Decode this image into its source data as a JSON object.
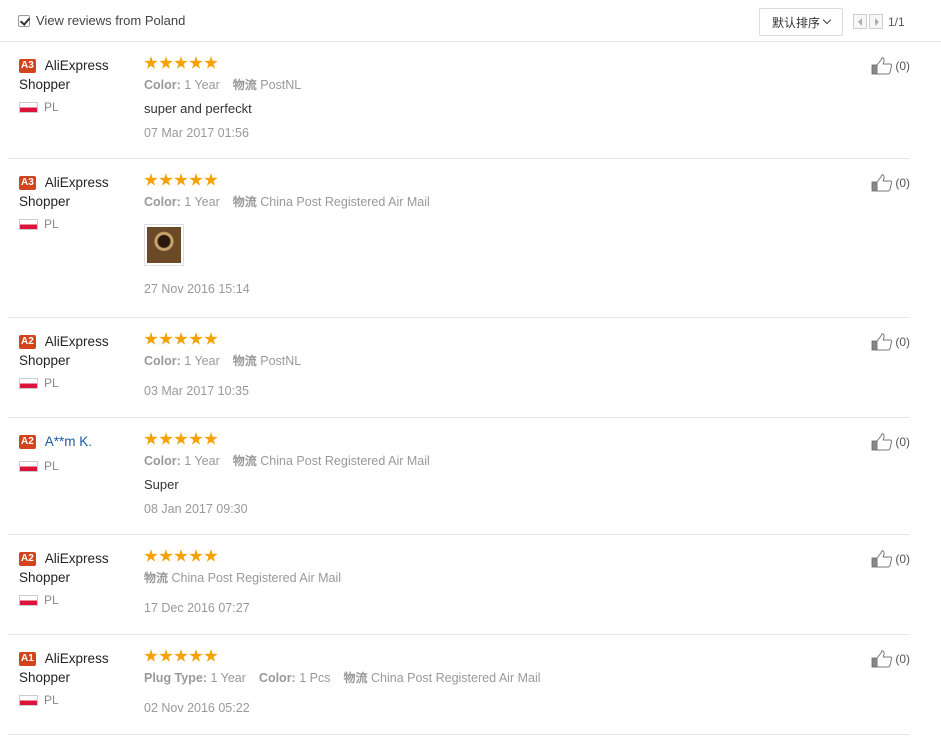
{
  "filter": {
    "label": "View reviews from Poland",
    "checked": true
  },
  "sort": {
    "label": "默认排序"
  },
  "pagination": {
    "text": "1/1"
  },
  "reviews": [
    {
      "level": "A3",
      "name": "AliExpress",
      "name2": "Shopper",
      "country": "PL",
      "stars": 5,
      "attrs": [
        {
          "label": "Color:",
          "value": "1 Year"
        },
        {
          "label": "物流",
          "value": "PostNL"
        }
      ],
      "text": "super and perfeckt",
      "date": "07 Mar 2017 01:56",
      "likes": "(0)"
    },
    {
      "level": "A3",
      "name": "AliExpress",
      "name2": "Shopper",
      "country": "PL",
      "stars": 5,
      "attrs": [
        {
          "label": "Color:",
          "value": "1 Year"
        },
        {
          "label": "物流",
          "value": "China Post Registered Air Mail"
        }
      ],
      "text": "",
      "photo": "review-photo-thumbnail",
      "date": "27 Nov 2016 15:14",
      "likes": "(0)"
    },
    {
      "level": "A2",
      "name": "AliExpress",
      "name2": "Shopper",
      "country": "PL",
      "stars": 5,
      "attrs": [
        {
          "label": "Color:",
          "value": "1 Year"
        },
        {
          "label": "物流",
          "value": "PostNL"
        }
      ],
      "text": "",
      "date": "03 Mar 2017 10:35",
      "likes": "(0)"
    },
    {
      "level": "A2",
      "name": "A**m K.",
      "name2": "",
      "country": "PL",
      "stars": 5,
      "attrs": [
        {
          "label": "Color:",
          "value": "1 Year"
        },
        {
          "label": "物流",
          "value": "China Post Registered Air Mail"
        }
      ],
      "text": "Super",
      "date": "08 Jan 2017 09:30",
      "likes": "(0)"
    },
    {
      "level": "A2",
      "name": "AliExpress",
      "name2": "Shopper",
      "country": "PL",
      "stars": 5,
      "attrs": [
        {
          "label": "物流",
          "value": "China Post Registered Air Mail"
        }
      ],
      "text": "",
      "date": "17 Dec 2016 07:27",
      "likes": "(0)"
    },
    {
      "level": "A1",
      "name": "AliExpress",
      "name2": "Shopper",
      "country": "PL",
      "stars": 5,
      "attrs": [
        {
          "label": "Plug Type:",
          "value": "1 Year"
        },
        {
          "label": "Color:",
          "value": "1 Pcs"
        },
        {
          "label": "物流",
          "value": "China Post Registered Air Mail"
        }
      ],
      "text": "",
      "date": "02 Nov 2016 05:22",
      "likes": "(0)"
    }
  ],
  "colors": {
    "star": "#f5a100",
    "level_badge": "#d2451c",
    "link": "#1a5aa6"
  }
}
